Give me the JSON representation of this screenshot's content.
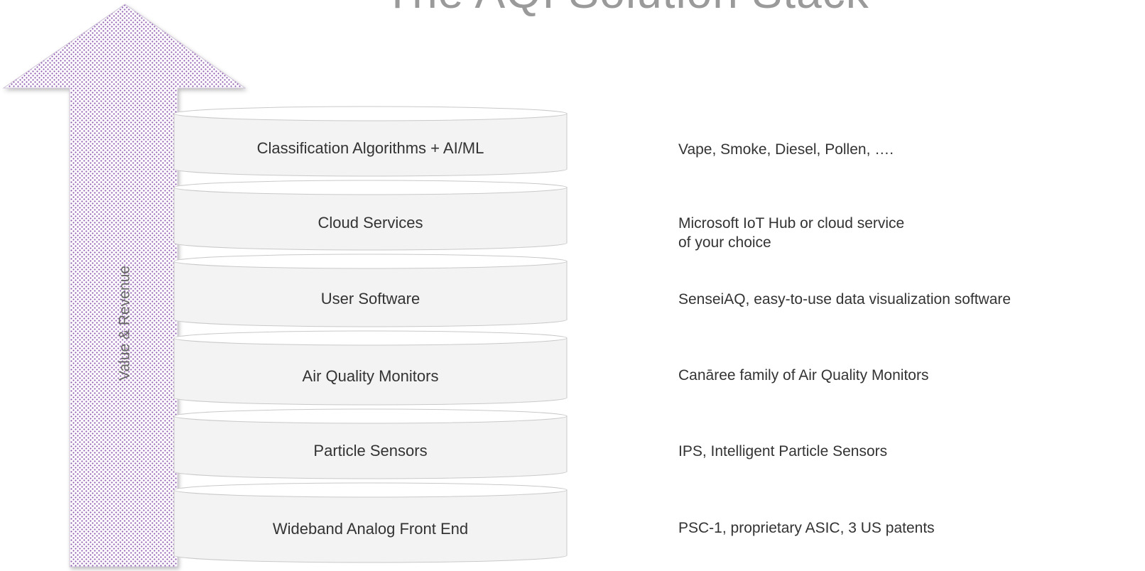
{
  "title": "The AQI Solution Stack",
  "arrow": {
    "label": "Value & Revenue",
    "dot_color": "#8e5bb0"
  },
  "layers": [
    {
      "name": "Classification Algorithms + AI/ML",
      "description": "Vape, Smoke, Diesel, Pollen, …."
    },
    {
      "name": "Cloud Services",
      "description": "Microsoft IoT Hub or cloud service of your choice"
    },
    {
      "name": "User Software",
      "description": "SenseiAQ, easy-to-use data visualization software"
    },
    {
      "name": "Air Quality Monitors",
      "description": "Canāree family of Air Quality Monitors"
    },
    {
      "name": "Particle Sensors",
      "description": "IPS, Intelligent Particle Sensors"
    },
    {
      "name": "Wideband Analog Front End",
      "description": "PSC-1, proprietary ASIC, 3 US patents"
    }
  ]
}
